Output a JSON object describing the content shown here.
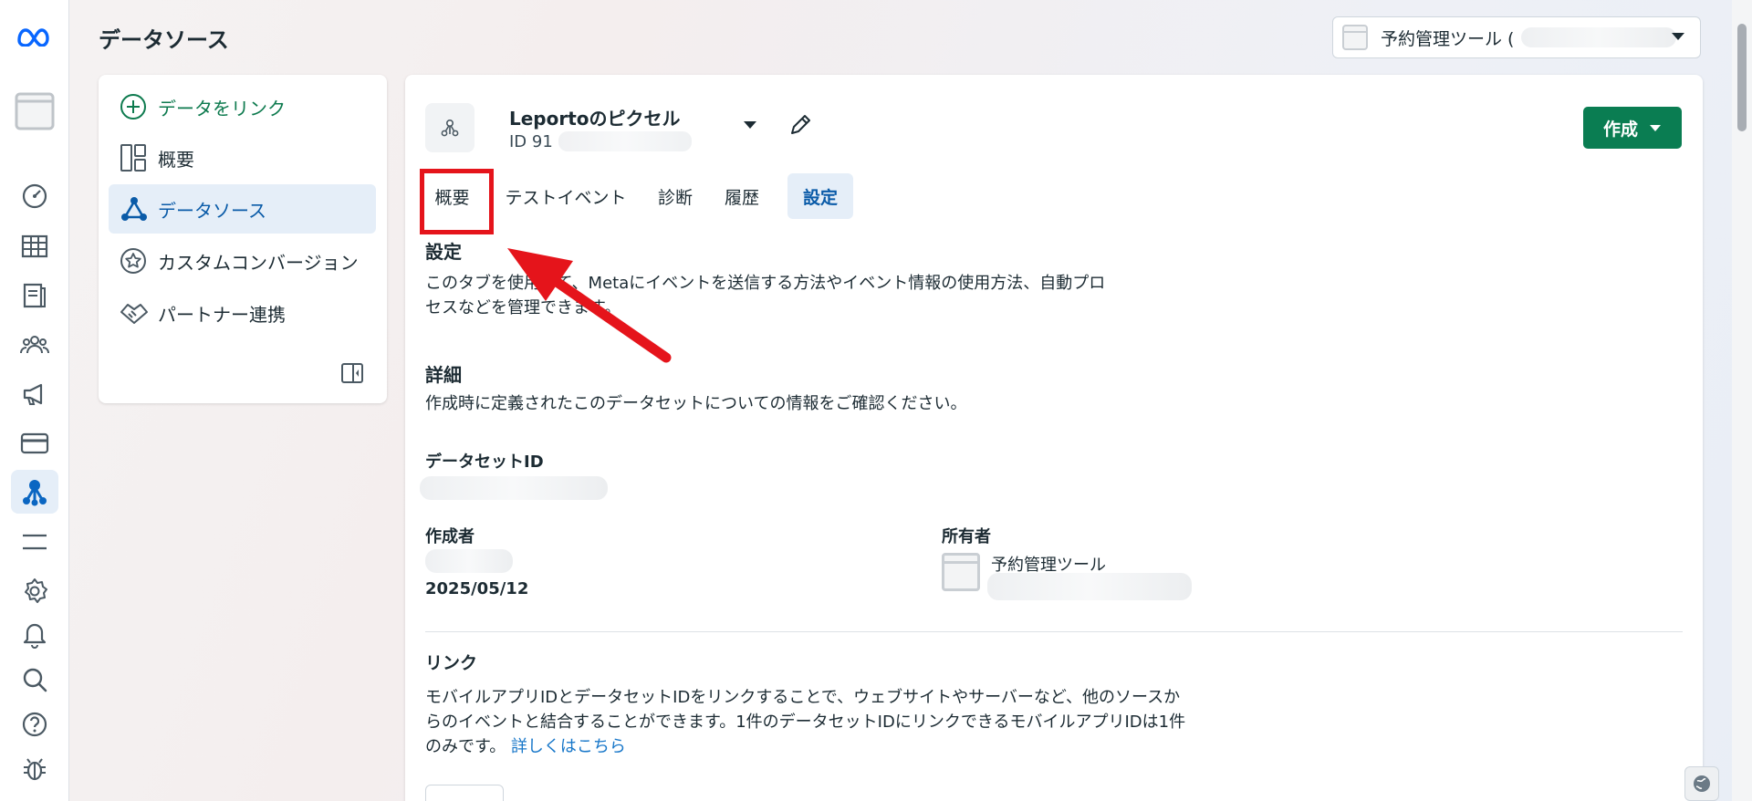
{
  "header": {
    "title": "データソース",
    "account_name": "予約管理ツール ("
  },
  "sidebar": {
    "items": [
      {
        "label": "データをリンク",
        "icon": "plus-circle-icon"
      },
      {
        "label": "概要",
        "icon": "layout-icon"
      },
      {
        "label": "データソース",
        "icon": "data-source-icon"
      },
      {
        "label": "カスタムコンバージョン",
        "icon": "star-circle-icon"
      },
      {
        "label": "パートナー連携",
        "icon": "handshake-icon"
      }
    ]
  },
  "rail": {
    "icons": [
      "meta-logo-icon",
      "account-thumb-icon",
      "dashboard-gauge-icon",
      "table-icon",
      "documents-icon",
      "audience-icon",
      "megaphone-icon",
      "billing-card-icon",
      "events-manager-icon",
      "menu-icon",
      "settings-icon",
      "notifications-icon",
      "search-icon",
      "help-icon",
      "bug-icon"
    ]
  },
  "pixel": {
    "name": "Leportoのピクセル",
    "id_prefix": "ID 91",
    "create_label": "作成"
  },
  "tabs": [
    {
      "label": "概要"
    },
    {
      "label": "テストイベント"
    },
    {
      "label": "診断"
    },
    {
      "label": "履歴"
    },
    {
      "label": "設定"
    }
  ],
  "settings_section": {
    "title": "設定",
    "description_line1": "このタブを使用して、Metaにイベントを送信する方法やイベント情報の使用方法、自動プロ",
    "description_line2": "セスなどを管理できます。"
  },
  "details_section": {
    "title": "詳細",
    "description": "作成時に定義されたこのデータセットについての情報をご確認ください。",
    "dataset_id_label": "データセットID",
    "creator_label": "作成者",
    "created_date": "2025/05/12",
    "owner_label": "所有者",
    "owner_name": "予約管理ツール"
  },
  "link_section": {
    "title": "リンク",
    "line1": "モバイルアプリIDとデータセットIDをリンクすることで、ウェブサイトやサーバーなど、他のソースか",
    "line2": "らのイベントと結合することができます。1件のデータセットIDにリンクできるモバイルアプリIDは1件",
    "line3": "のみです。",
    "learn_more": "詳しくはこちら"
  },
  "colors": {
    "accent_green": "#0a7d52",
    "active_blue": "#0a5ba8",
    "highlight_red": "#e5141b"
  }
}
